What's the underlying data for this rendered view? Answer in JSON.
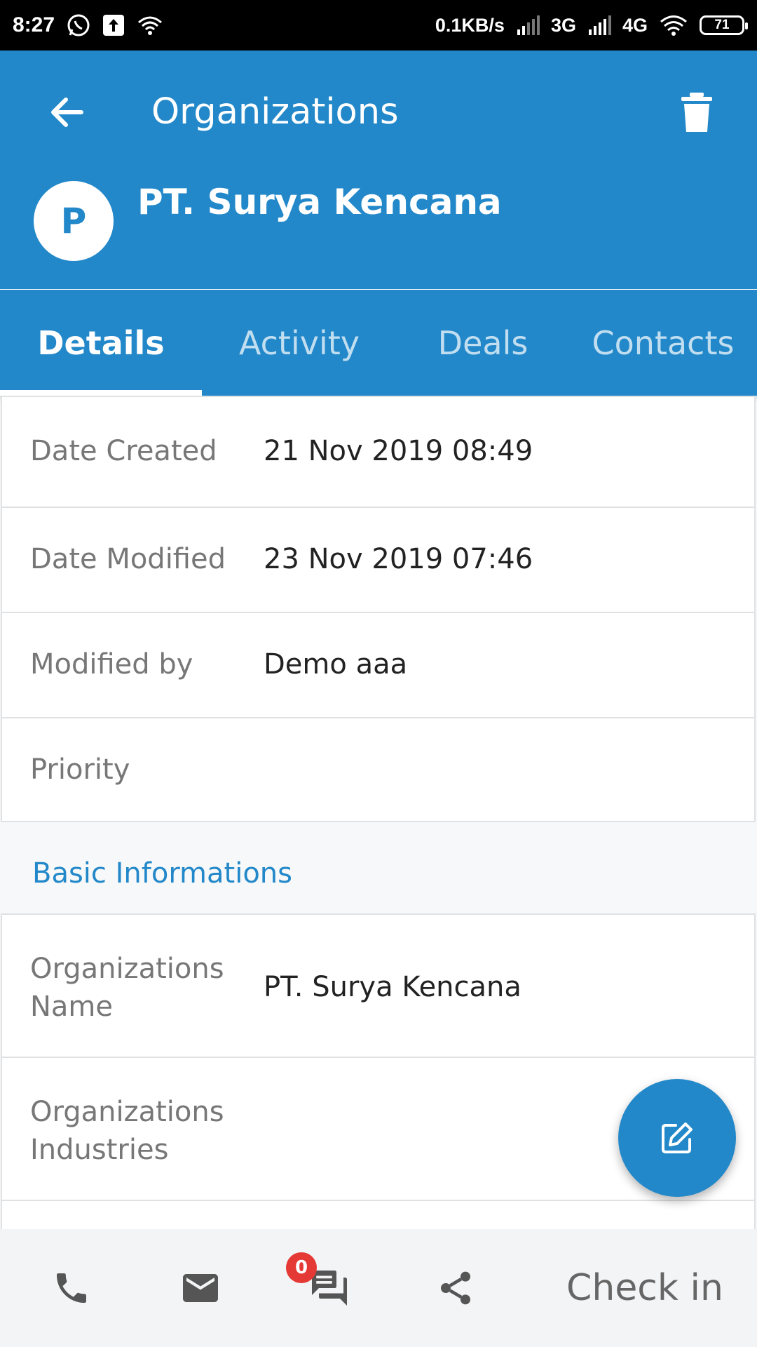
{
  "status_bar": {
    "time": "8:27",
    "network_speed": "0.1KB/s",
    "net_3g": "3G",
    "net_4g": "4G",
    "battery": "71"
  },
  "header": {
    "title": "Organizations",
    "avatar_letter": "P",
    "org_name": "PT. Surya Kencana",
    "color": "#2288c9"
  },
  "tabs": [
    {
      "label": "Details",
      "active": true
    },
    {
      "label": "Activity",
      "active": false
    },
    {
      "label": "Deals",
      "active": false
    },
    {
      "label": "Contacts",
      "active": false
    }
  ],
  "meta_rows": [
    {
      "label": "Date Created",
      "value": "21 Nov 2019 08:49"
    },
    {
      "label": "Date Modified",
      "value": "23 Nov 2019 07:46"
    },
    {
      "label": "Modified by",
      "value": "Demo aaa"
    },
    {
      "label": "Priority",
      "value": ""
    }
  ],
  "basic_section": {
    "title": "Basic Informations",
    "rows": [
      {
        "label": "Organizations Name",
        "value": "PT. Surya Kencana"
      },
      {
        "label": "Organizations Industries",
        "value": ""
      }
    ]
  },
  "bottom_bar": {
    "icons": [
      "phone-icon",
      "mail-icon",
      "chat-icon",
      "share-icon"
    ],
    "chat_badge": "0",
    "checkin_label": "Check in"
  }
}
